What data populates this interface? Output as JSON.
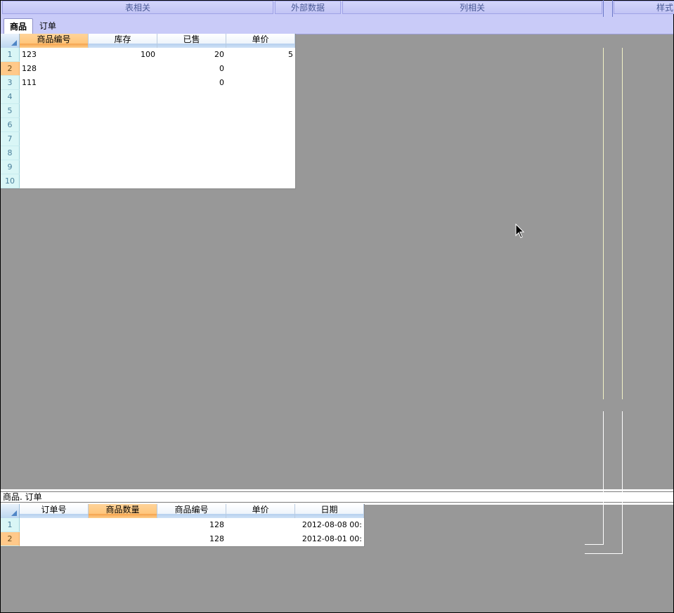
{
  "ribbon": {
    "groups": [
      "表相关",
      "外部数据",
      "列相关",
      "样式"
    ]
  },
  "tabs": [
    {
      "label": "商品",
      "active": true
    },
    {
      "label": "订单",
      "active": false
    }
  ],
  "product_grid": {
    "columns": [
      "商品编号",
      "库存",
      "已售",
      "单价"
    ],
    "selected_column": 0,
    "row_numbers": [
      "1",
      "2",
      "3",
      "4",
      "5",
      "6",
      "7",
      "8",
      "9",
      "10"
    ],
    "selected_row": 1,
    "rows": [
      [
        "123",
        "100",
        "20",
        "5"
      ],
      [
        "128",
        "",
        "0",
        ""
      ],
      [
        "111",
        "",
        "0",
        ""
      ]
    ]
  },
  "relation_bar": {
    "text": "商品. 订单"
  },
  "order_grid": {
    "columns": [
      "订单号",
      "商品数量",
      "商品编号",
      "单价",
      "日期"
    ],
    "selected_column": 1,
    "row_numbers": [
      "1",
      "2"
    ],
    "selected_row": 1,
    "rows": [
      [
        "",
        "",
        "128",
        "",
        "2012-08-08 00:"
      ],
      [
        "",
        "",
        "128",
        "",
        "2012-08-01 00:"
      ]
    ]
  },
  "colors": {
    "ribbon_bg": "#c9cbf8",
    "workspace_bg": "#989898",
    "header_selected": "#ffc57a",
    "rowheader_bg": "#d9f6f6"
  }
}
